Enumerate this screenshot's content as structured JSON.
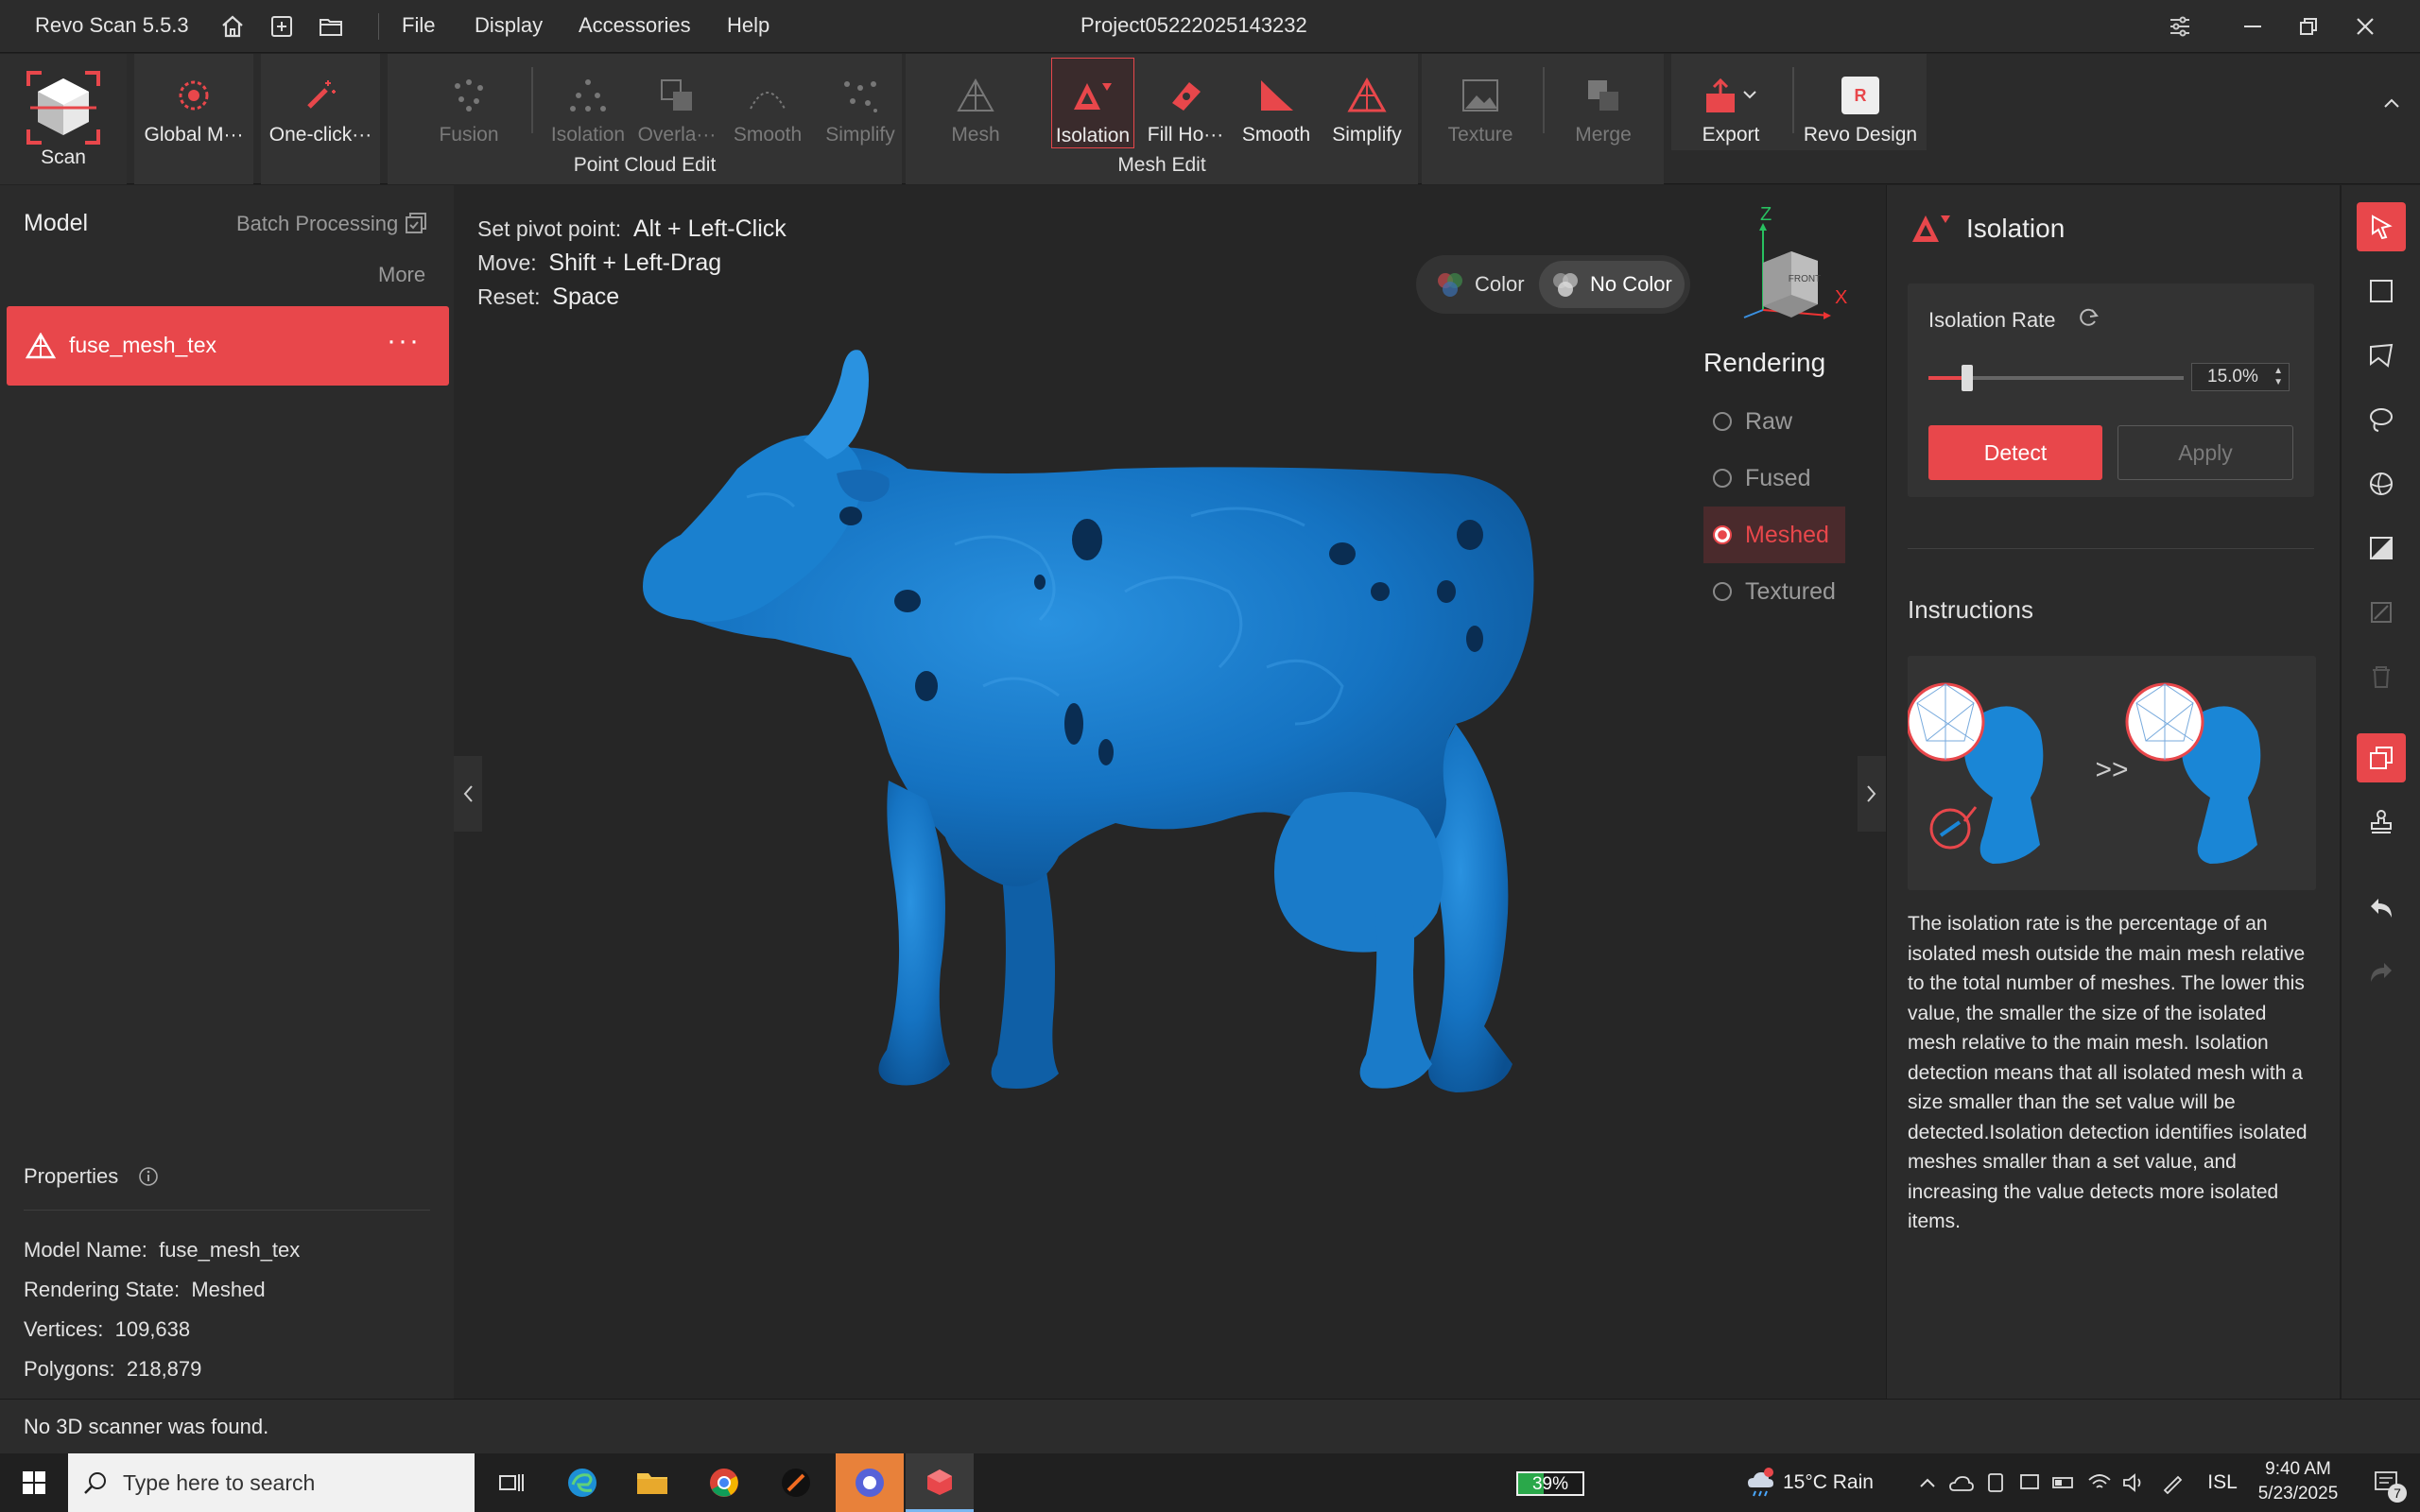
{
  "window": {
    "app_name": "Revo Scan 5.5.3",
    "menu": [
      "File",
      "Display",
      "Accessories",
      "Help"
    ],
    "project_title": "Project05222025143232"
  },
  "ribbon": {
    "scan": "Scan",
    "global": "Global M···",
    "oneclick": "One-click···",
    "pc_fusion": "Fusion",
    "pc_isolation": "Isolation",
    "pc_overlap": "Overla···",
    "pc_smooth": "Smooth",
    "pc_simplify": "Simplify",
    "pc_group": "Point Cloud Edit",
    "mesh": "Mesh",
    "me_isolation": "Isolation",
    "me_fillholes": "Fill Ho···",
    "me_smooth": "Smooth",
    "me_simplify": "Simplify",
    "me_group": "Mesh Edit",
    "texture": "Texture",
    "merge": "Merge",
    "export": "Export",
    "revo_design": "Revo Design",
    "accent": "#e8474b"
  },
  "left": {
    "title": "Model",
    "batch": "Batch Processing",
    "more": "More",
    "model_item": "fuse_mesh_tex",
    "properties_title": "Properties",
    "props": [
      {
        "k": "Model Name:",
        "v": "fuse_mesh_tex"
      },
      {
        "k": "Rendering State:",
        "v": "Meshed"
      },
      {
        "k": "Vertices:",
        "v": "109,638"
      },
      {
        "k": "Polygons:",
        "v": "218,879"
      }
    ]
  },
  "viewport": {
    "hints": [
      {
        "k": "Set pivot point:",
        "v": "Alt + Left-Click"
      },
      {
        "k": "Move:",
        "v": "Shift + Left-Drag"
      },
      {
        "k": "Reset:",
        "v": "Space"
      }
    ],
    "color": "Color",
    "no_color": "No Color",
    "rendering_title": "Rendering",
    "rendering": [
      "Raw",
      "Fused",
      "Meshed",
      "Textured"
    ],
    "rendering_selected": "Meshed",
    "axis": {
      "z": "Z",
      "x": "X",
      "cube_face": "FRONT"
    },
    "model_color": "#1a7bc9"
  },
  "right": {
    "title": "Isolation",
    "rate_label": "Isolation Rate",
    "rate_value": "15.0%",
    "rate_fraction": 0.15,
    "detect": "Detect",
    "apply": "Apply",
    "instructions_title": "Instructions",
    "instructions_text": "The isolation rate is the percentage of an isolated mesh outside the main mesh relative to the total number of meshes. The lower this value, the smaller the size of the isolated mesh relative to the main mesh. Isolation detection means that all isolated mesh with a size smaller than the set value will be detected.Isolation detection identifies isolated meshes smaller than a set value, and increasing the value detects more isolated items.",
    "arrow": ">>"
  },
  "status": {
    "message": "No 3D scanner was found."
  },
  "taskbar": {
    "search_placeholder": "Type here to search",
    "battery": "39%",
    "weather": "15°C  Rain",
    "lang": "ISL",
    "time": "9:40 AM",
    "date": "5/23/2025",
    "notif_count": "7"
  }
}
